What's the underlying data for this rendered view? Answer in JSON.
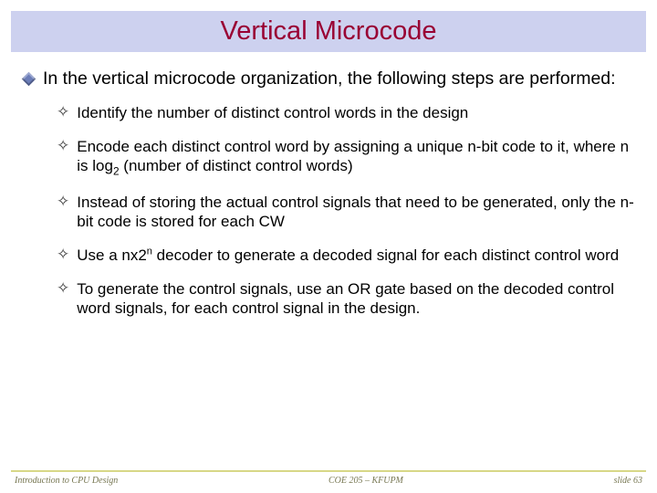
{
  "title": "Vertical Microcode",
  "intro": "In the vertical microcode organization, the following steps are performed:",
  "steps": [
    {
      "html": "Identify the number of distinct control words in the design"
    },
    {
      "html": "Encode each distinct control word by assigning a unique n-bit code to it, where n is log<sub>2</sub> (number of distinct control words)"
    },
    {
      "html": "Instead of storing the actual control signals that need to be generated, only the n-bit code is stored for each CW"
    },
    {
      "html": "Use a nx2<sup class=\"sml\">n</sup> decoder to generate a decoded signal for each distinct control word"
    },
    {
      "html": "To generate the control signals, use an OR gate based on the decoded control word signals, for each control signal in the design."
    }
  ],
  "footer": {
    "left": "Introduction to CPU Design",
    "center": "COE 205 – KFUPM",
    "right": "slide 63"
  }
}
